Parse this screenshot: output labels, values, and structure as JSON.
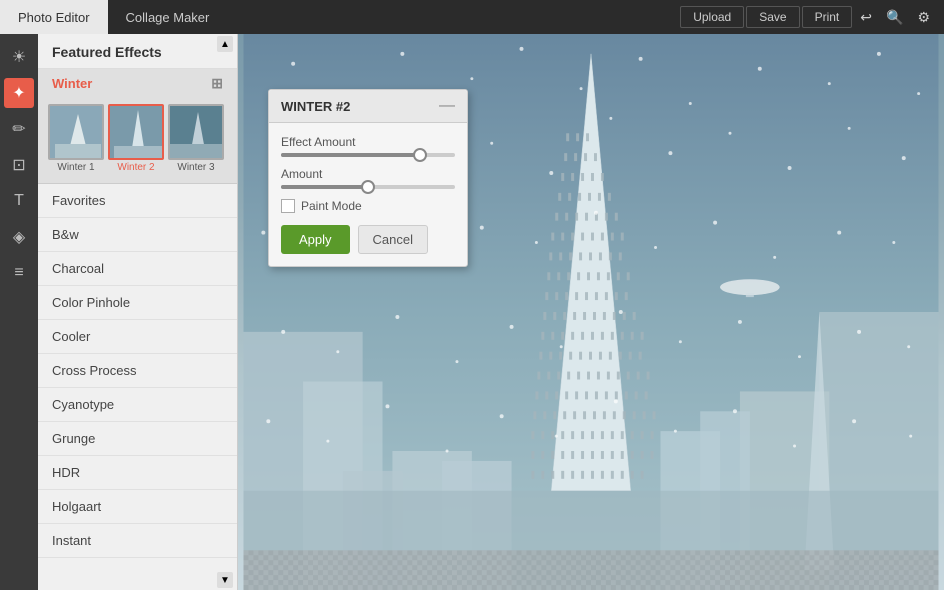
{
  "tabs": [
    {
      "id": "photo-editor",
      "label": "Photo Editor",
      "active": true
    },
    {
      "id": "collage-maker",
      "label": "Collage Maker",
      "active": false
    }
  ],
  "topActions": {
    "upload": "Upload",
    "save": "Save",
    "print": "Print"
  },
  "sidebar": {
    "featuredEffectsLabel": "Featured Effects",
    "activeFilter": "Winter",
    "adjustIconLabel": "⊞",
    "filterItems": [
      {
        "id": "winter1",
        "label": "Winter 1",
        "selected": false
      },
      {
        "id": "winter2",
        "label": "Winter 2",
        "selected": true
      },
      {
        "id": "winter3",
        "label": "Winter 3",
        "selected": false
      }
    ],
    "categories": [
      {
        "id": "favorites",
        "label": "Favorites"
      },
      {
        "id": "bw",
        "label": "B&w"
      },
      {
        "id": "charcoal",
        "label": "Charcoal"
      },
      {
        "id": "color-pinhole",
        "label": "Color Pinhole"
      },
      {
        "id": "cooler",
        "label": "Cooler"
      },
      {
        "id": "cross-process",
        "label": "Cross Process"
      },
      {
        "id": "cyanotype",
        "label": "Cyanotype"
      },
      {
        "id": "grunge",
        "label": "Grunge"
      },
      {
        "id": "hdr",
        "label": "HDR"
      },
      {
        "id": "holgaart",
        "label": "Holgaart"
      },
      {
        "id": "instant",
        "label": "Instant"
      }
    ]
  },
  "tools": [
    {
      "id": "sun",
      "icon": "☀",
      "active": false
    },
    {
      "id": "wand",
      "icon": "✦",
      "active": true
    },
    {
      "id": "pencil",
      "icon": "✏",
      "active": false
    },
    {
      "id": "crop",
      "icon": "⊡",
      "active": false
    },
    {
      "id": "text",
      "icon": "T",
      "active": false
    },
    {
      "id": "box3d",
      "icon": "◈",
      "active": false
    },
    {
      "id": "lines",
      "icon": "≡",
      "active": false
    }
  ],
  "popup": {
    "title": "WINTER #2",
    "closeIcon": "—",
    "effectAmountLabel": "Effect Amount",
    "amountLabel": "Amount",
    "effectSliderValue": 80,
    "amountSliderValue": 50,
    "paintModeLabel": "Paint Mode",
    "paintModeChecked": false,
    "applyLabel": "Apply",
    "cancelLabel": "Cancel"
  }
}
